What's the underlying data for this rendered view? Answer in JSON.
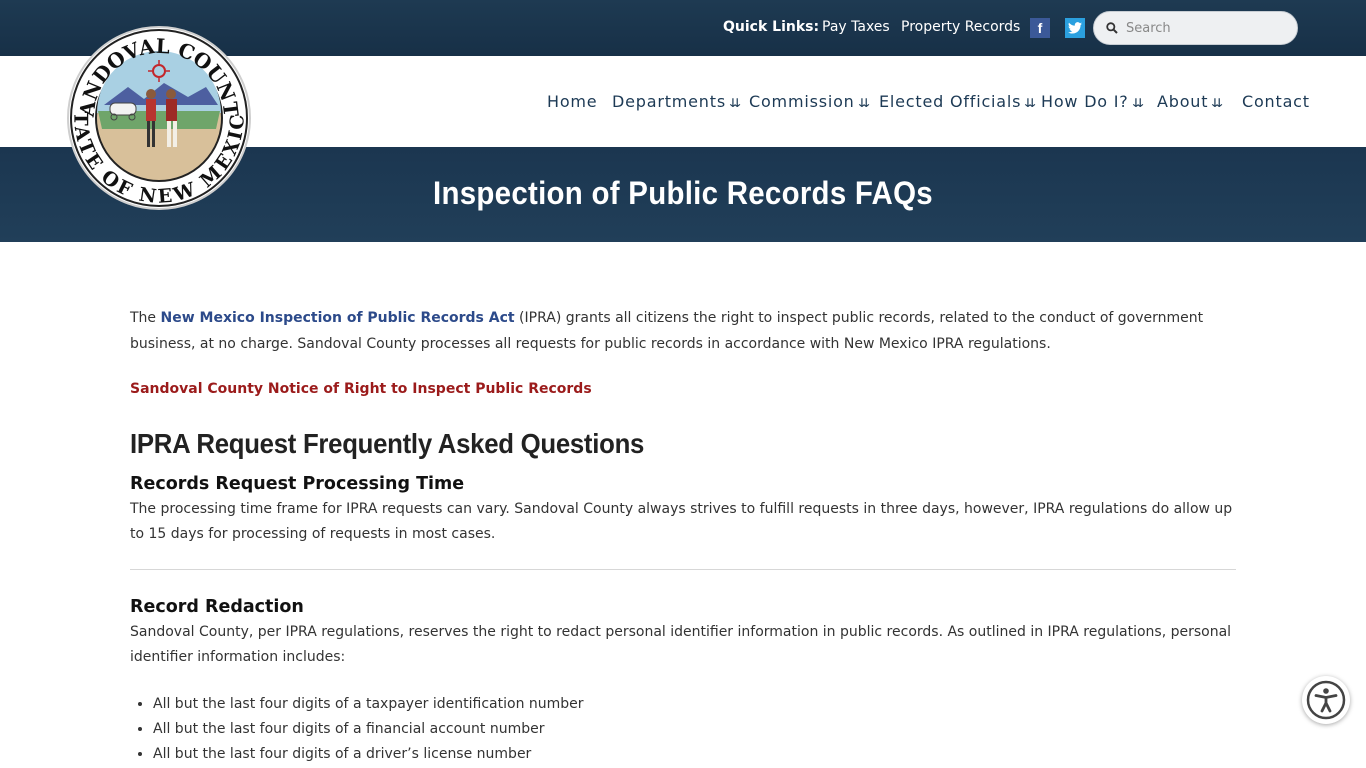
{
  "topbar": {
    "quick_links_label": "Quick Links:",
    "links": [
      "Pay Taxes",
      "Property Records"
    ],
    "facebook_glyph": "f",
    "search_placeholder": "Search"
  },
  "logo": {
    "top_text": "SANDOVAL COUNTY",
    "bottom_text": "STATE OF NEW MEXICO"
  },
  "nav": {
    "items": [
      "Home",
      "Departments",
      "Commission",
      "Elected Officials",
      "How Do I?",
      "About",
      "Contact"
    ]
  },
  "banner": {
    "title": "Inspection of Public Records FAQs"
  },
  "content": {
    "intro_prefix": "The ",
    "intro_link": "New Mexico Inspection of Public Records Act",
    "intro_suffix": " (IPRA) grants all citizens the right to inspect public records, related to the conduct of government business, at no charge. Sandoval County processes all requests for public records in accordance with New Mexico IPRA regulations.",
    "notice_link": "Sandoval County Notice of Right to Inspect Public Records",
    "faq_heading": "IPRA Request Frequently Asked Questions",
    "section1_title": "Records Request Processing Time",
    "section1_text": "The processing time frame for IPRA requests can vary. Sandoval County always strives to fulfill requests in three days, however, IPRA regulations do allow up to 15 days for processing of requests in most cases.",
    "section2_title": "Record Redaction",
    "section2_text": "Sandoval County, per IPRA regulations, reserves the right to redact personal identifier information in public records. As outlined in IPRA regulations, personal identifier information includes:",
    "bullets": [
      "All but the last four digits of a taxpayer identification number",
      "All but the last four digits of a financial account number",
      "All but the last four digits of a driver’s license number"
    ]
  },
  "colors": {
    "header_dark": "#1b3650",
    "nav_text": "#1d3a55",
    "link_blue": "#2c4a8a",
    "notice_red": "#9b1b1b"
  },
  "icons": [
    "search-icon",
    "facebook-icon",
    "twitter-icon",
    "chevron-down-icon",
    "accessibility-icon"
  ]
}
